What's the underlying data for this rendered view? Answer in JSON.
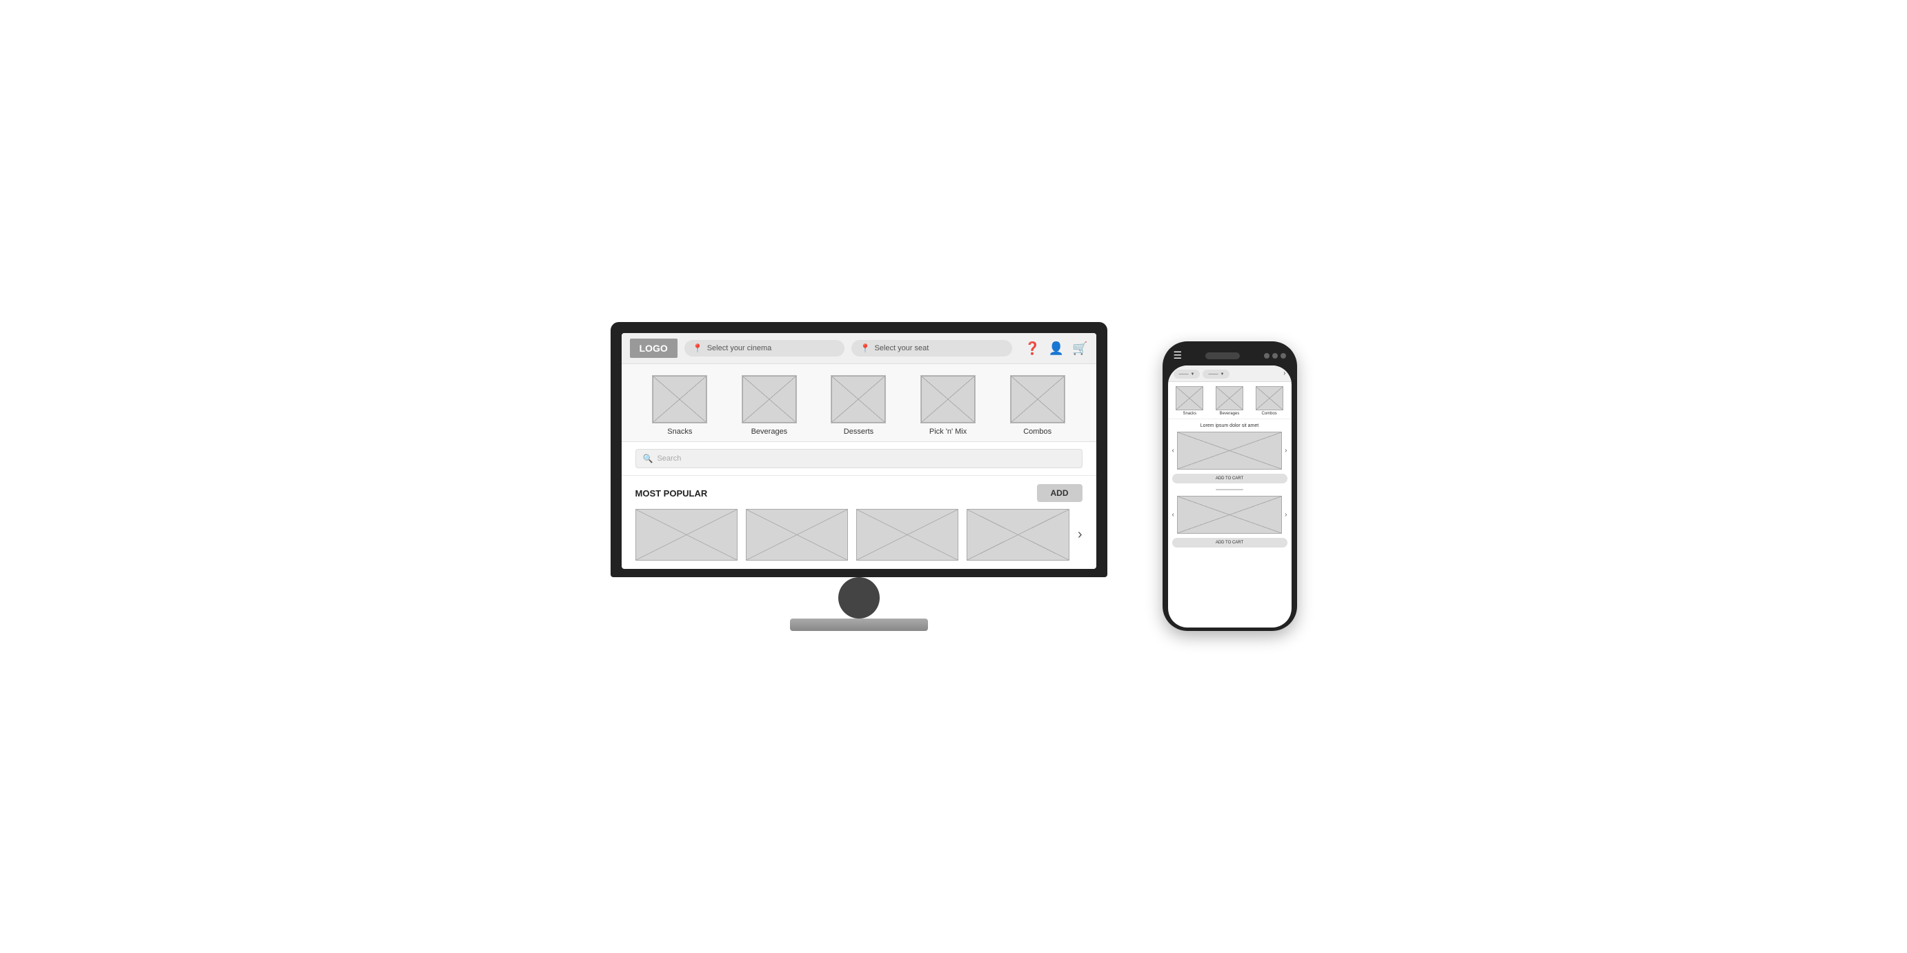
{
  "monitor": {
    "logo": "LOGO",
    "header": {
      "cinema_placeholder": "Select your cinema",
      "seat_placeholder": "Select your seat"
    },
    "categories": [
      {
        "label": "Snacks"
      },
      {
        "label": "Beverages"
      },
      {
        "label": "Desserts"
      },
      {
        "label": "Pick 'n' Mix"
      },
      {
        "label": "Combos"
      }
    ],
    "search_placeholder": "Search",
    "section": {
      "title": "MOST POPULAR",
      "add_button": "ADD"
    }
  },
  "phone": {
    "dropdown1": "———",
    "dropdown2": "———",
    "categories": [
      {
        "label": "Snacks"
      },
      {
        "label": "Beverages"
      },
      {
        "label": "Combos"
      }
    ],
    "product_title": "Lorem ipsum dolor sit amet",
    "add_to_cart": "ADD TO CART",
    "add_to_cart2": "ADD TO CART"
  }
}
